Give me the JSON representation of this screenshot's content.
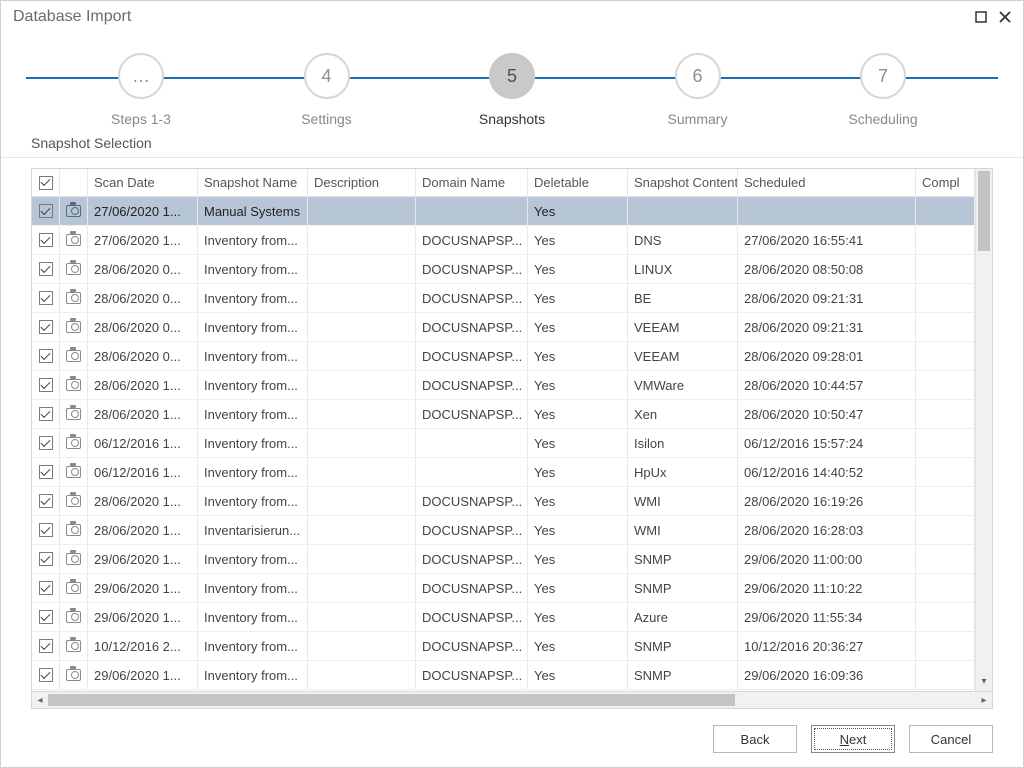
{
  "window": {
    "title": "Database Import"
  },
  "wizard": {
    "steps": [
      {
        "num": "…",
        "label": "Steps 1-3",
        "current": false
      },
      {
        "num": "4",
        "label": "Settings",
        "current": false
      },
      {
        "num": "5",
        "label": "Snapshots",
        "current": true
      },
      {
        "num": "6",
        "label": "Summary",
        "current": false
      },
      {
        "num": "7",
        "label": "Scheduling",
        "current": false
      }
    ]
  },
  "section_title": "Snapshot Selection",
  "columns": {
    "chk": "",
    "ico": "",
    "scan_date": "Scan Date",
    "snapshot_name": "Snapshot Name",
    "description": "Description",
    "domain_name": "Domain Name",
    "deletable": "Deletable",
    "snapshot_content": "Snapshot Content",
    "scheduled": "Scheduled",
    "completed": "Compl"
  },
  "rows": [
    {
      "checked": true,
      "selected": true,
      "scan_date": "27/06/2020 1...",
      "snapshot_name": "Manual Systems",
      "description": "",
      "domain_name": "",
      "deletable": "Yes",
      "content": "",
      "scheduled": ""
    },
    {
      "checked": true,
      "selected": false,
      "scan_date": "27/06/2020 1...",
      "snapshot_name": "Inventory from...",
      "description": "",
      "domain_name": "DOCUSNAPSP...",
      "deletable": "Yes",
      "content": "DNS",
      "scheduled": "27/06/2020 16:55:41"
    },
    {
      "checked": true,
      "selected": false,
      "scan_date": "28/06/2020 0...",
      "snapshot_name": "Inventory from...",
      "description": "",
      "domain_name": "DOCUSNAPSP...",
      "deletable": "Yes",
      "content": "LINUX",
      "scheduled": "28/06/2020 08:50:08"
    },
    {
      "checked": true,
      "selected": false,
      "scan_date": "28/06/2020 0...",
      "snapshot_name": "Inventory from...",
      "description": "",
      "domain_name": "DOCUSNAPSP...",
      "deletable": "Yes",
      "content": "BE",
      "scheduled": "28/06/2020 09:21:31"
    },
    {
      "checked": true,
      "selected": false,
      "scan_date": "28/06/2020 0...",
      "snapshot_name": "Inventory from...",
      "description": "",
      "domain_name": "DOCUSNAPSP...",
      "deletable": "Yes",
      "content": "VEEAM",
      "scheduled": "28/06/2020 09:21:31"
    },
    {
      "checked": true,
      "selected": false,
      "scan_date": "28/06/2020 0...",
      "snapshot_name": "Inventory from...",
      "description": "",
      "domain_name": "DOCUSNAPSP...",
      "deletable": "Yes",
      "content": "VEEAM",
      "scheduled": "28/06/2020 09:28:01"
    },
    {
      "checked": true,
      "selected": false,
      "scan_date": "28/06/2020 1...",
      "snapshot_name": "Inventory from...",
      "description": "",
      "domain_name": "DOCUSNAPSP...",
      "deletable": "Yes",
      "content": "VMWare",
      "scheduled": "28/06/2020 10:44:57"
    },
    {
      "checked": true,
      "selected": false,
      "scan_date": "28/06/2020 1...",
      "snapshot_name": "Inventory from...",
      "description": "",
      "domain_name": "DOCUSNAPSP...",
      "deletable": "Yes",
      "content": "Xen",
      "scheduled": "28/06/2020 10:50:47"
    },
    {
      "checked": true,
      "selected": false,
      "scan_date": "06/12/2016 1...",
      "snapshot_name": "Inventory from...",
      "description": "",
      "domain_name": "",
      "deletable": "Yes",
      "content": "Isilon",
      "scheduled": "06/12/2016 15:57:24"
    },
    {
      "checked": true,
      "selected": false,
      "scan_date": "06/12/2016 1...",
      "snapshot_name": "Inventory from...",
      "description": "",
      "domain_name": "",
      "deletable": "Yes",
      "content": "HpUx",
      "scheduled": "06/12/2016 14:40:52"
    },
    {
      "checked": true,
      "selected": false,
      "scan_date": "28/06/2020 1...",
      "snapshot_name": "Inventory from...",
      "description": "",
      "domain_name": "DOCUSNAPSP...",
      "deletable": "Yes",
      "content": "WMI",
      "scheduled": "28/06/2020 16:19:26"
    },
    {
      "checked": true,
      "selected": false,
      "scan_date": "28/06/2020 1...",
      "snapshot_name": "Inventarisierun...",
      "description": "",
      "domain_name": "DOCUSNAPSP...",
      "deletable": "Yes",
      "content": "WMI",
      "scheduled": "28/06/2020 16:28:03"
    },
    {
      "checked": true,
      "selected": false,
      "scan_date": "29/06/2020 1...",
      "snapshot_name": "Inventory from...",
      "description": "",
      "domain_name": "DOCUSNAPSP...",
      "deletable": "Yes",
      "content": "SNMP",
      "scheduled": "29/06/2020 11:00:00"
    },
    {
      "checked": true,
      "selected": false,
      "scan_date": "29/06/2020 1...",
      "snapshot_name": "Inventory from...",
      "description": "",
      "domain_name": "DOCUSNAPSP...",
      "deletable": "Yes",
      "content": "SNMP",
      "scheduled": "29/06/2020 11:10:22"
    },
    {
      "checked": true,
      "selected": false,
      "scan_date": "29/06/2020 1...",
      "snapshot_name": "Inventory from...",
      "description": "",
      "domain_name": "DOCUSNAPSP...",
      "deletable": "Yes",
      "content": "Azure",
      "scheduled": "29/06/2020 11:55:34"
    },
    {
      "checked": true,
      "selected": false,
      "scan_date": "10/12/2016 2...",
      "snapshot_name": "Inventory from...",
      "description": "",
      "domain_name": "DOCUSNAPSP...",
      "deletable": "Yes",
      "content": "SNMP",
      "scheduled": "10/12/2016 20:36:27"
    },
    {
      "checked": true,
      "selected": false,
      "scan_date": "29/06/2020 1...",
      "snapshot_name": "Inventory from...",
      "description": "",
      "domain_name": "DOCUSNAPSP...",
      "deletable": "Yes",
      "content": "SNMP",
      "scheduled": "29/06/2020 16:09:36"
    }
  ],
  "buttons": {
    "back": "Back",
    "next_prefix": "N",
    "next_suffix": "ext",
    "cancel": "Cancel"
  }
}
